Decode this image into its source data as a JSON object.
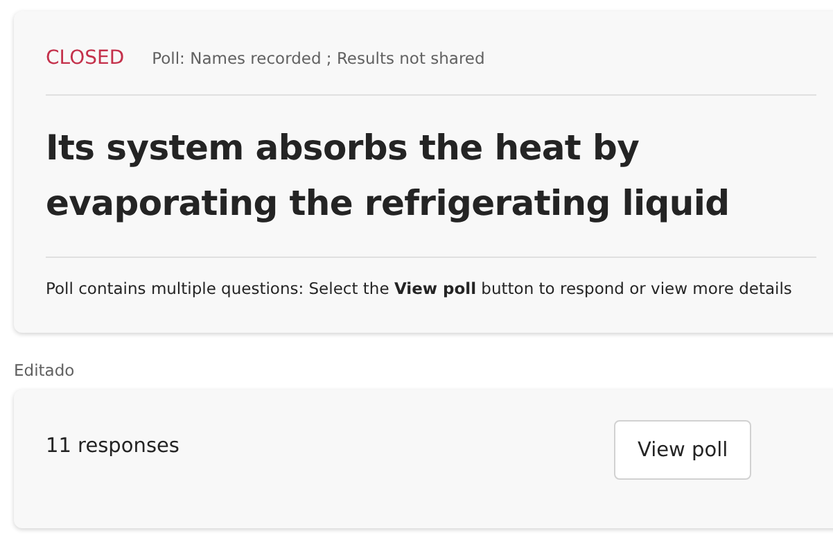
{
  "poll_card": {
    "status": "CLOSED",
    "meta": "Poll: Names recorded ; Results not shared",
    "question": "Its system absorbs the heat by evaporating the refrigerating liquid",
    "note": "Poll contains multiple questions: Select the **View poll** button to respond or view more details"
  },
  "edited_label": "Editado",
  "footer_card": {
    "responses": "11 responses",
    "button": "View poll"
  }
}
